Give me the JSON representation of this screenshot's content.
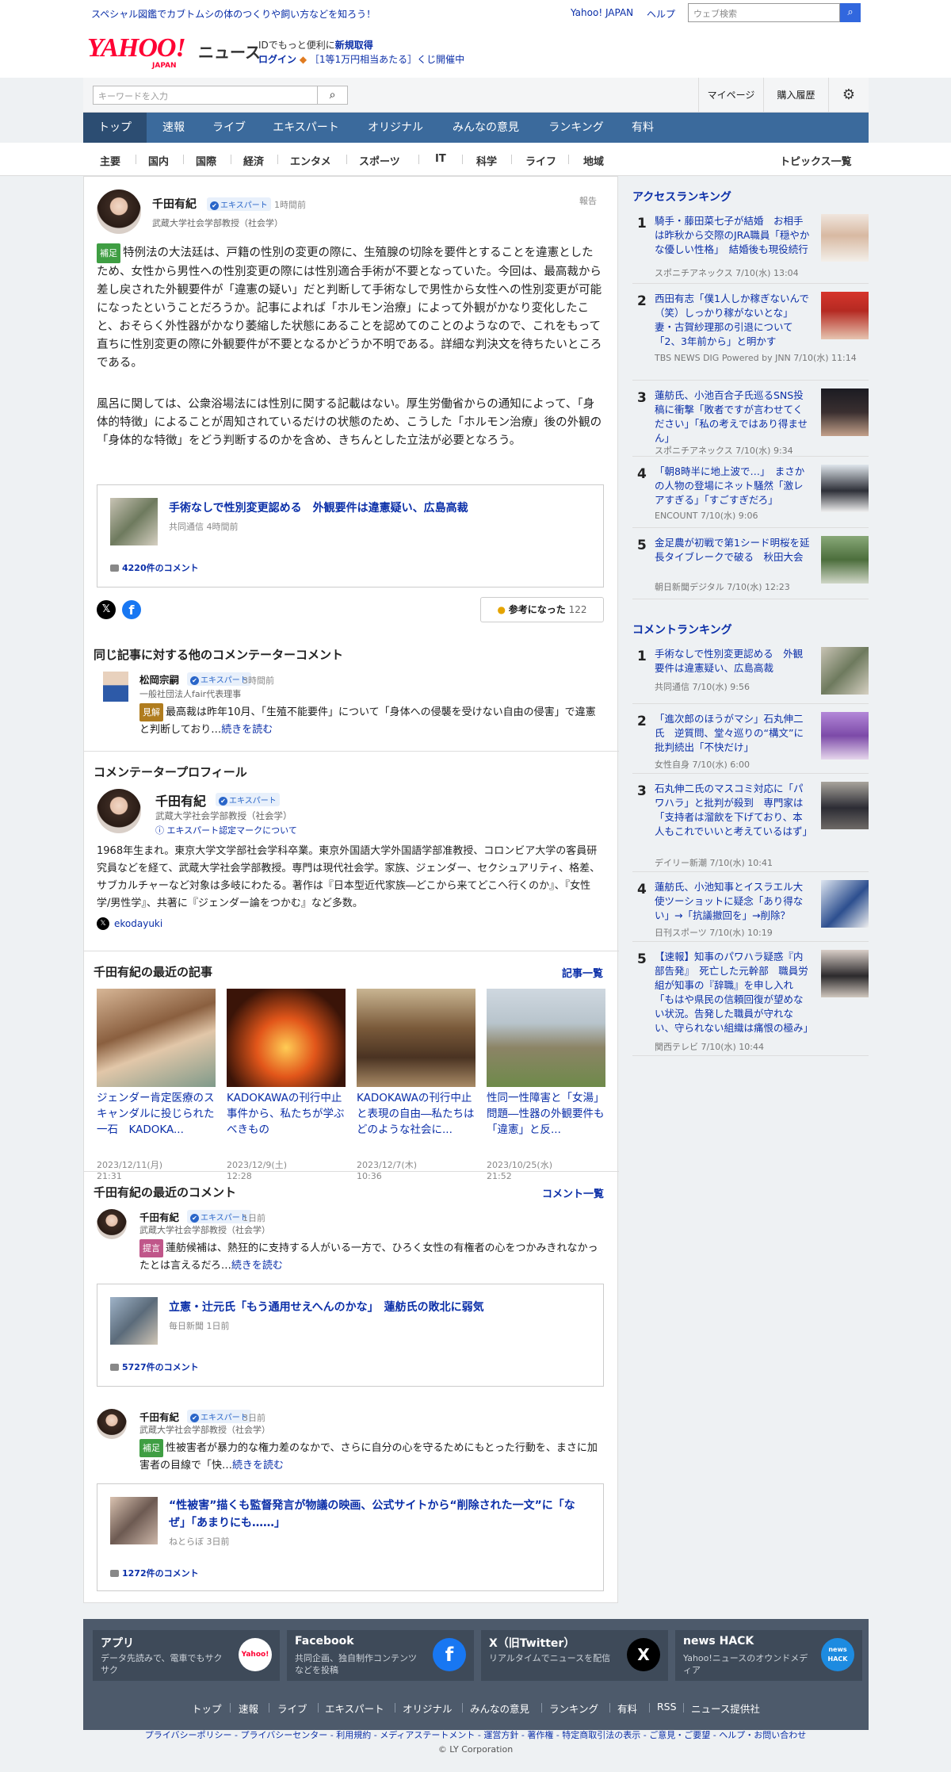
{
  "topbar": {
    "promo": "スペシャル図鑑でカブトムシの体のつくりや飼い方などを知ろう！",
    "yahoo_japan": "Yahoo! JAPAN",
    "help": "ヘルプ",
    "web_search_placeholder": "ウェブ検索"
  },
  "header": {
    "logo": "YAHOO!",
    "logo_sub": "JAPAN",
    "news": "ニュース",
    "id_text": "IDでもっと便利に",
    "signup": "新規取得",
    "login": "ログイン",
    "lottery": "［1等1万円相当あたる］くじ開催中"
  },
  "search": {
    "placeholder": "キーワードを入力",
    "mypage": "マイページ",
    "history": "購入履歴"
  },
  "gnav": [
    "トップ",
    "速報",
    "ライブ",
    "エキスパート",
    "オリジナル",
    "みんなの意見",
    "ランキング",
    "有料"
  ],
  "subnav": [
    "主要",
    "国内",
    "国際",
    "経済",
    "エンタメ",
    "スポーツ",
    "IT",
    "科学",
    "ライフ",
    "地域"
  ],
  "subnav_all": "トピックス一覧",
  "comment": {
    "author": "千田有紀",
    "badge": "エキスパート",
    "time": "1時間前",
    "affil": "武蔵大学社会学部教授（社会学）",
    "report": "報告",
    "tag": "補足",
    "p1": "特例法の大法廷は、戸籍の性別の変更の際に、生殖腺の切除を要件とすることを違憲としたため、女性から男性への性別変更の際には性別適合手術が不要となっていた。今回は、最高裁から差し戻された外観要件が「違憲の疑い」だと判断して手術なしで男性から女性への性別変更が可能になったということだろうか。記事によれば「ホルモン治療」によって外観がかなり変化したこと、おそらく外性器がかなり萎縮した状態にあることを認めてのことのようなので、これをもって直ちに性別変更の際に外観要件が不要となるかどうか不明である。詳細な判決文を待ちたいところである。",
    "p2": "風呂に関しては、公衆浴場法には性別に関する記載はない。厚生労働省からの通知によって、「身体的特徴」によることが周知されているだけの状態のため、こうした「ホルモン治療」後の外観の「身体的な特徴」をどう判断するのかを含め、きちんとした立法が必要となろう。",
    "article": {
      "title": "手術なしで性別変更認める　外観要件は違憲疑い、広島高裁",
      "source": "共同通信 4時間前",
      "comments": "4220件のコメント"
    },
    "helpful": "参考になった",
    "helpful_count": "122"
  },
  "others": {
    "heading": "同じ記事に対する他のコメンテーターコメント",
    "name": "松岡宗嗣",
    "badge": "エキスパート",
    "time": "3時間前",
    "affil": "一般社団法人fair代表理事",
    "tag": "見解",
    "text": "最高裁は昨年10月、「生殖不能要件」について「身体への侵襲を受けない自由の侵害」で違憲と判断しており…",
    "more": "続きを読む"
  },
  "profile": {
    "heading": "コメンテータープロフィール",
    "name": "千田有紀",
    "badge": "エキスパート",
    "affil": "武蔵大学社会学部教授（社会学）",
    "mark": "エキスパート認定マークについて",
    "bio": "1968年生まれ。東京大学文学部社会学科卒業。東京外国語大学外国語学部准教授、コロンビア大学の客員研究員などを経て、武蔵大学社会学部教授。専門は現代社会学。家族、ジェンダー、セクシュアリティ、格差、サブカルチャーなど対象は多岐にわたる。著作は『日本型近代家族―どこから来てどこへ行くのか』、『女性学/男性学』、共著に『ジェンダー論をつかむ』など多数。",
    "x_handle": "ekodayuki"
  },
  "recent_articles": {
    "heading": "千田有紀の最近の記事",
    "more": "記事一覧",
    "items": [
      {
        "title": "ジェンダー肯定医療のスキャンダルに投じられた一石　KADOKA...",
        "date": "2023/12/11(月) 21:31"
      },
      {
        "title": "KADOKAWAの刊行中止事件から、私たちが学ぶべきもの",
        "date": "2023/12/9(土) 12:28"
      },
      {
        "title": "KADOKAWAの刊行中止と表現の自由―私たちはどのような社会に...",
        "date": "2023/12/7(木) 10:36"
      },
      {
        "title": "性同一性障害と「女湯」問題―性器の外観要件も「違憲」と反...",
        "date": "2023/10/25(水) 21:52"
      }
    ]
  },
  "recent_comments": {
    "heading": "千田有紀の最近のコメント",
    "more": "コメント一覧",
    "items": [
      {
        "name": "千田有紀",
        "badge": "エキスパート",
        "time": "1日前",
        "affil": "武蔵大学社会学部教授（社会学）",
        "tag": "提言",
        "text": "蓮舫候補は、熱狂的に支持する人がいる一方で、ひろく女性の有権者の心をつかみきれなかったとは言えるだろ…",
        "more": "続きを読む",
        "article_title": "立憲・辻元氏「もう通用せえへんのかな」　蓮舫氏の敗北に弱気",
        "article_source": "毎日新聞 1日前",
        "article_comments": "5727件のコメント"
      },
      {
        "name": "千田有紀",
        "badge": "エキスパート",
        "time": "3日前",
        "affil": "武蔵大学社会学部教授（社会学）",
        "tag": "補足",
        "text": "性被害者が暴力的な権力差のなかで、さらに自分の心を守るためにもとった行動を、まさに加害者の目線で「快…",
        "more": "続きを読む",
        "article_title": "“性被害”描くも監督発言が物議の映画、公式サイトから“削除された一文”に「なぜ」「あまりにも……」",
        "article_source": "ねとらぼ 3日前",
        "article_comments": "1272件のコメント"
      }
    ]
  },
  "access_ranking": {
    "heading": "アクセスランキング",
    "items": [
      {
        "rank": "1",
        "title": "騎手・藤田菜七子が結婚　お相手は昨秋から交際のJRA職員「穏やかな優しい性格」　結婚後も現役続行",
        "source": "スポニチアネックス 7/10(水) 13:04"
      },
      {
        "rank": "2",
        "title": "西田有志「僕1人しか稼ぎないんで（笑）しっかり稼がないとな」妻・古賀紗理那の引退について「2、3年前から」と明かす",
        "source": "TBS NEWS DIG Powered by JNN 7/10(水) 11:14"
      },
      {
        "rank": "3",
        "title": "蓮舫氏、小池百合子氏巡るSNS投稿に衝撃「敗者ですが言わせてください」「私の考えではあり得ません」",
        "source": "スポニチアネックス 7/10(水) 9:34"
      },
      {
        "rank": "4",
        "title": "「朝8時半に地上波で…」　まさかの人物の登場にネット騒然「激レアすぎる」「すごすぎだろ」",
        "source": "ENCOUNT 7/10(水) 9:06"
      },
      {
        "rank": "5",
        "title": "金足農が初戦で第1シード明桜を延長タイブレークで破る　秋田大会",
        "source": "朝日新聞デジタル 7/10(水) 12:23"
      }
    ]
  },
  "comment_ranking": {
    "heading": "コメントランキング",
    "items": [
      {
        "rank": "1",
        "title": "手術なしで性別変更認める　外観要件は違憲疑い、広島高裁",
        "source": "共同通信 7/10(水) 9:56"
      },
      {
        "rank": "2",
        "title": "「進次郎のほうがマシ」石丸伸二氏　逆質問、堂々巡りの“構文”に批判続出「不快だけ」",
        "source": "女性自身 7/10(水) 6:00"
      },
      {
        "rank": "3",
        "title": "石丸伸二氏のマスコミ対応に「パワハラ」と批判が殺到　専門家は「支持者は溜飲を下げており、本人もこれでいいと考えているはず」",
        "source": "デイリー新潮 7/10(水) 10:41"
      },
      {
        "rank": "4",
        "title": "蓮舫氏、小池知事とイスラエル大使ツーショットに疑念「あり得ない」→「抗議撤回を」→削除？",
        "source": "日刊スポーツ 7/10(水) 10:19"
      },
      {
        "rank": "5",
        "title": "【速報】知事のパワハラ疑惑『内部告発』　死亡した元幹部　職員労組が知事の『辞職』を申し入れ「もはや県民の信頼回復が望めない状況。告発した職員が守れない、守られない組織は痛恨の極み」",
        "source": "関西テレビ 7/10(水) 10:44"
      }
    ]
  },
  "footer": {
    "boxes": [
      {
        "title": "アプリ",
        "desc": "データ先読みで、電車でもサクサク",
        "icon": "Yahoo!"
      },
      {
        "title": "Facebook",
        "desc": "共同企画、独自制作コンテンツなどを投稿",
        "icon": "f"
      },
      {
        "title": "X（旧Twitter）",
        "desc": "リアルタイムでニュースを配信",
        "icon": "X"
      },
      {
        "title": "news HACK",
        "desc": "Yahoo!ニュースのオウンドメディア",
        "icon": "news HACK"
      }
    ],
    "links": [
      "トップ",
      "速報",
      "ライブ",
      "エキスパート",
      "オリジナル",
      "みんなの意見",
      "ランキング",
      "有料",
      "RSS",
      "ニュース提供社"
    ],
    "legal": "プライバシーポリシー - プライバシーセンター - 利用規約 - メディアステートメント - 運営方針 - 著作権 - 特定商取引法の表示 - ご意見・ご要望 - ヘルプ・お問い合わせ",
    "copyright": "© LY Corporation"
  },
  "colors": {
    "accent": "#3b6a9c",
    "link": "#0b2fa8",
    "brand": "#ff0033"
  }
}
